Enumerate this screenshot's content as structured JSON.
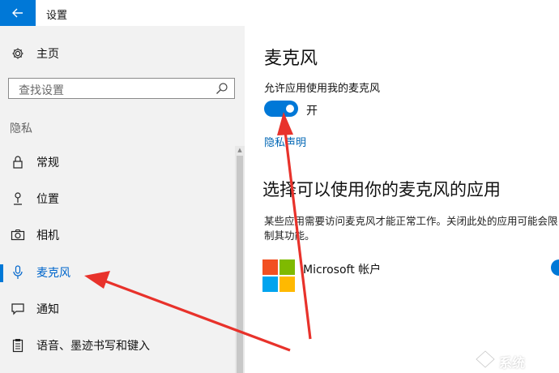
{
  "window": {
    "title": "设置"
  },
  "colors": {
    "accent": "#0078d7",
    "link": "#0066b4",
    "annotation_arrow": "#e8322b"
  },
  "sidebar": {
    "home_label": "主页",
    "search": {
      "placeholder": "查找设置"
    },
    "section_heading": "隐私",
    "items": [
      {
        "label": "常规",
        "icon": "lock-icon"
      },
      {
        "label": "位置",
        "icon": "location-icon"
      },
      {
        "label": "相机",
        "icon": "camera-icon"
      },
      {
        "label": "麦克风",
        "icon": "microphone-icon",
        "selected": true
      },
      {
        "label": "通知",
        "icon": "notification-icon"
      },
      {
        "label": "语音、墨迹书写和键入",
        "icon": "clipboard-icon"
      }
    ]
  },
  "main": {
    "title": "麦克风",
    "permission_label": "允许应用使用我的麦克风",
    "toggle_state": "开",
    "privacy_link": "隐私声明",
    "apps_heading": "选择可以使用你的麦克风的应用",
    "apps_description": "某些应用需要访问麦克风才能正常工作。关闭此处的应用可能会限制其功能。",
    "apps": [
      {
        "name": "Microsoft 帐户",
        "icon": "microsoft-logo",
        "enabled": true
      }
    ]
  },
  "watermark": {
    "text": "系统"
  }
}
